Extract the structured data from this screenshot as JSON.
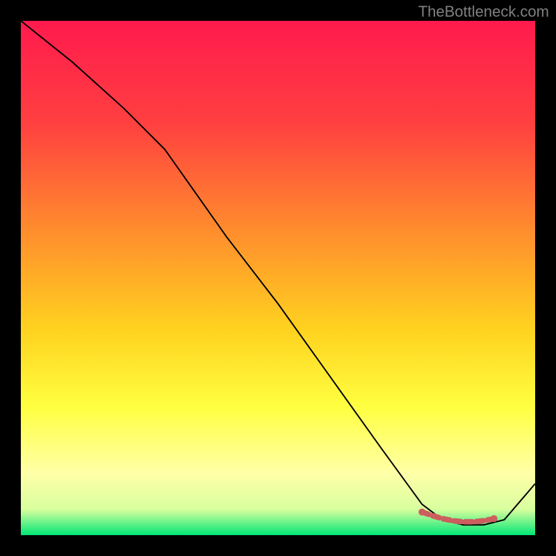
{
  "source_label": "TheBottleneck.com",
  "chart_data": {
    "type": "line",
    "title": "",
    "xlabel": "",
    "ylabel": "",
    "xlim": [
      0,
      100
    ],
    "ylim": [
      0,
      100
    ],
    "grid": false,
    "series": [
      {
        "name": "curve",
        "color": "#000000",
        "x": [
          0,
          10,
          20,
          28,
          40,
          50,
          60,
          70,
          78,
          82,
          86,
          90,
          94,
          100
        ],
        "y": [
          100,
          92,
          83,
          75,
          58,
          45,
          31,
          17,
          6,
          3,
          2,
          2,
          3,
          10
        ]
      },
      {
        "name": "markers",
        "color": "#cc5e5e",
        "type": "scatter",
        "x": [
          78,
          80,
          82,
          84,
          86,
          88,
          90,
          92
        ],
        "y": [
          4.5,
          3.8,
          3.2,
          2.8,
          2.6,
          2.6,
          2.8,
          3.2
        ]
      }
    ],
    "background_gradient": {
      "stops": [
        {
          "offset": 0.0,
          "color": "#ff1a4d"
        },
        {
          "offset": 0.2,
          "color": "#ff4040"
        },
        {
          "offset": 0.4,
          "color": "#ff8a2e"
        },
        {
          "offset": 0.6,
          "color": "#ffd21f"
        },
        {
          "offset": 0.75,
          "color": "#ffff40"
        },
        {
          "offset": 0.88,
          "color": "#ffffa8"
        },
        {
          "offset": 0.95,
          "color": "#d8ff9e"
        },
        {
          "offset": 1.0,
          "color": "#00e676"
        }
      ]
    }
  }
}
